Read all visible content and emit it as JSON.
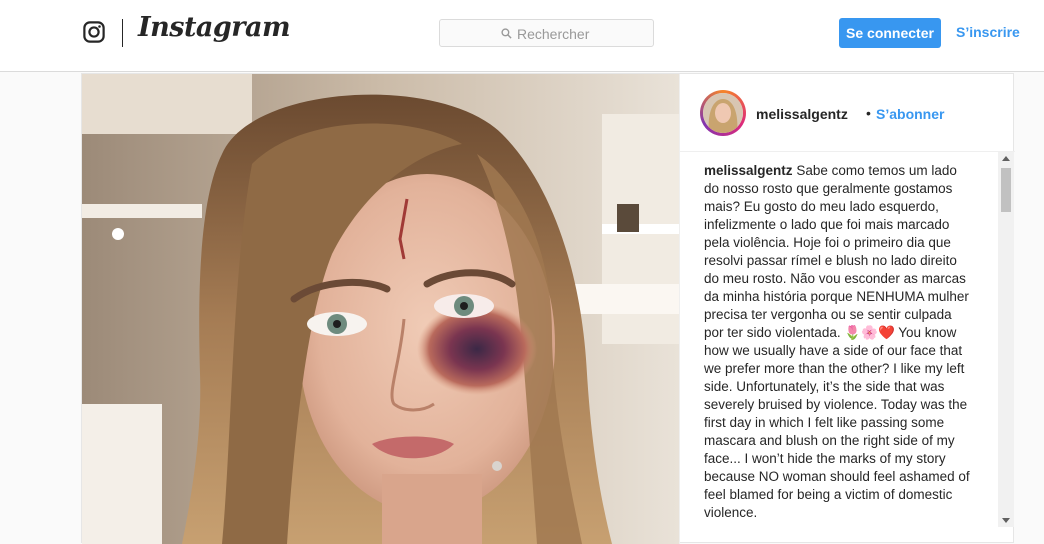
{
  "header": {
    "logo_icon": "instagram-glyph-icon",
    "wordmark": "Instagram",
    "search": {
      "icon": "search-icon",
      "placeholder": "Rechercher"
    },
    "login_label": "Se connecter",
    "signup_label": "S’inscrire"
  },
  "post": {
    "image_icon": "post-photo",
    "author": {
      "username": "melissalgentz",
      "separator": "•",
      "follow_label": "S’abonner",
      "avatar_icon": "avatar"
    },
    "caption": {
      "username": "melissalgentz",
      "text": "Sabe como temos um lado do nosso rosto que geralmente gostamos mais? Eu gosto do meu lado esquerdo, infelizmente o lado que foi mais marcado pela violência. Hoje foi o primeiro dia que resolvi passar rímel e blush no lado direito do meu rosto. Não vou esconder as marcas da minha história porque NENHUMA mulher precisa ter vergonha ou se sentir culpada por ter sido violentada. 🌷🌸❤️ You know how we usually have a side of our face that we prefer more than the other? I like my left side. Unfortunately, it’s the side that was severely bruised by violence. Today was the first day in which I felt like passing some mascara and blush on the right side of my face... I won’t hide the marks of my story because NO woman should feel ashamed of feel blamed for being a victim of domestic violence."
    }
  },
  "colors": {
    "accent": "#3897f0",
    "border": "#dbdbdb",
    "text": "#262626",
    "muted": "#999999"
  }
}
